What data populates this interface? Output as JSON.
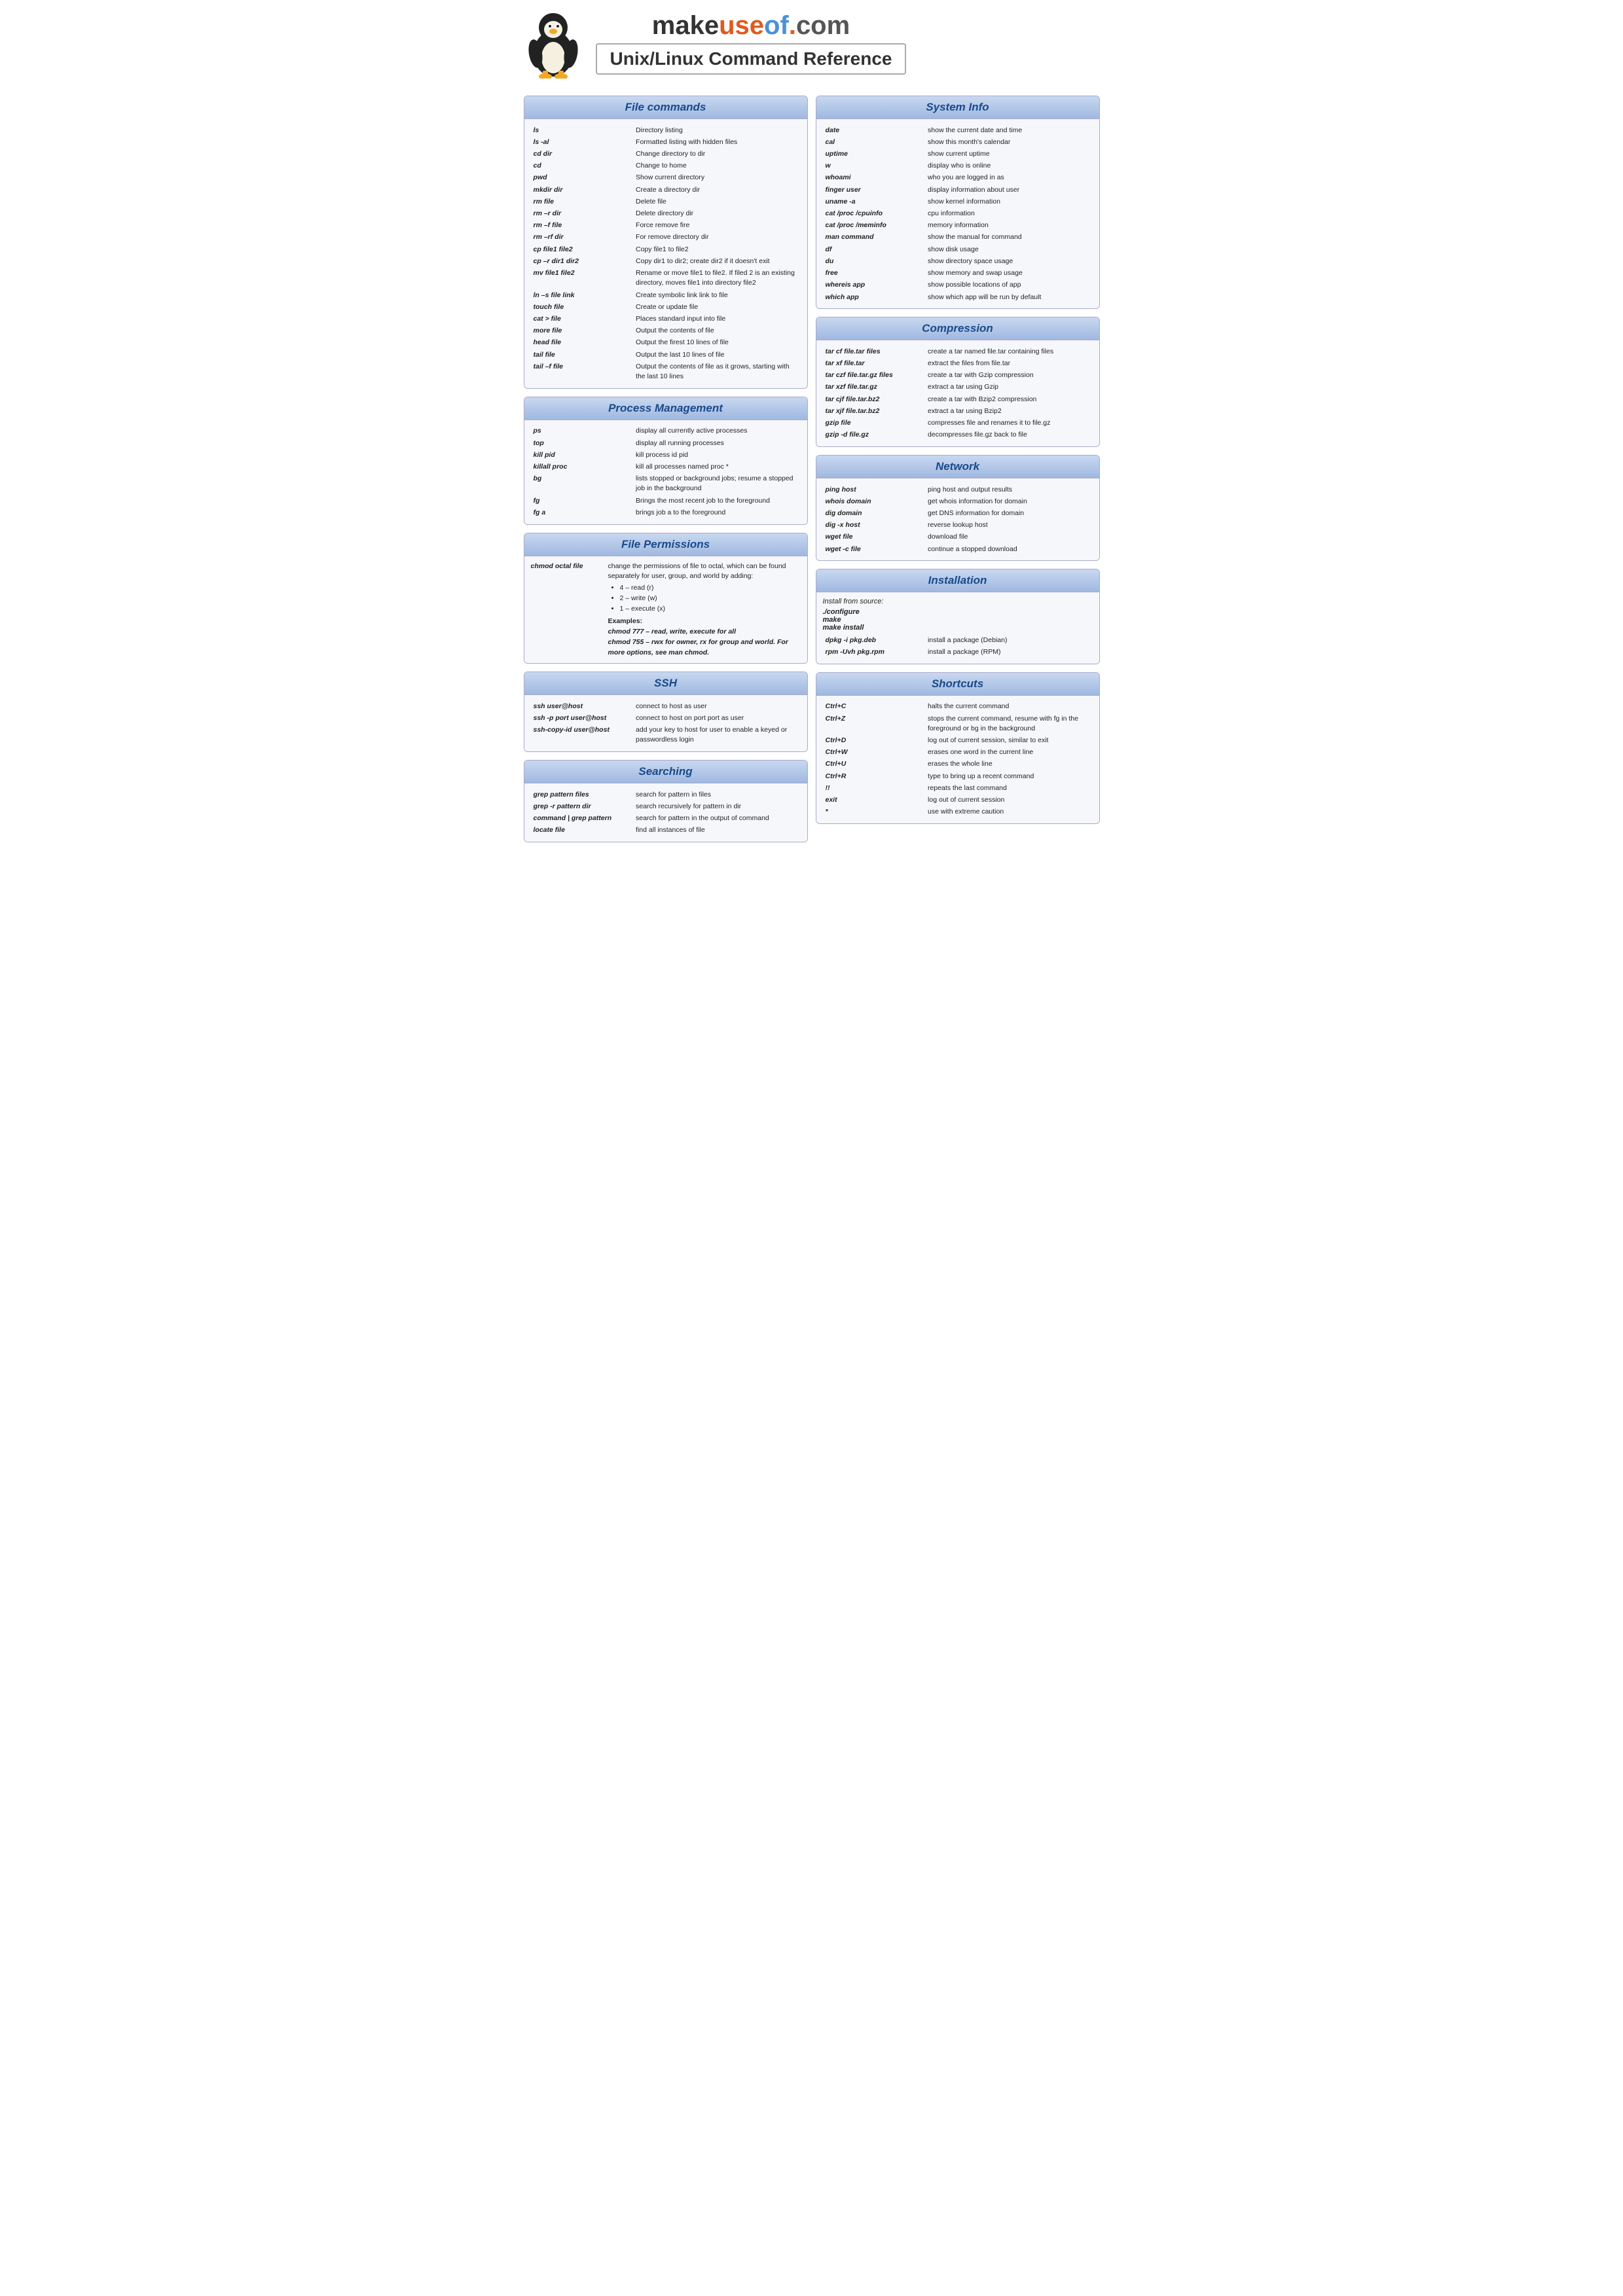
{
  "brand": {
    "make": "make",
    "use": "use",
    "of": "of",
    "dot": ".",
    "com": "com",
    "tagline": "Unix/Linux Command Reference"
  },
  "sections": {
    "file_commands": {
      "title": "File commands",
      "commands": [
        {
          "cmd": "ls",
          "desc": "Directory listing"
        },
        {
          "cmd": "ls -al",
          "desc": "Formatted listing with hidden files"
        },
        {
          "cmd": "cd dir",
          "desc": "Change directory to dir"
        },
        {
          "cmd": "cd",
          "desc": "Change to home"
        },
        {
          "cmd": "pwd",
          "desc": "Show current directory"
        },
        {
          "cmd": "mkdir dir",
          "desc": "Create a directory dir"
        },
        {
          "cmd": "rm file",
          "desc": "Delete file"
        },
        {
          "cmd": "rm –r dir",
          "desc": "Delete directory dir"
        },
        {
          "cmd": "rm –f file",
          "desc": "Force remove fire"
        },
        {
          "cmd": "rm –rf dir",
          "desc": "For remove directory dir"
        },
        {
          "cmd": "cp file1 file2",
          "desc": "Copy file1 to file2"
        },
        {
          "cmd": "cp –r dir1 dir2",
          "desc": "Copy dir1 to dir2; create dir2 if it doesn't exit"
        },
        {
          "cmd": "mv file1 file2",
          "desc": "Rename or move file1 to file2. If filed 2 is an existing directory, moves file1 into directory file2"
        },
        {
          "cmd": "ln –s file link",
          "desc": "Create symbolic link link to file"
        },
        {
          "cmd": "touch file",
          "desc": "Create or update file"
        },
        {
          "cmd": "cat > file",
          "desc": "Places standard input into file"
        },
        {
          "cmd": "more file",
          "desc": "Output the contents of file"
        },
        {
          "cmd": "head file",
          "desc": "Output the firest 10 lines of file"
        },
        {
          "cmd": "tail file",
          "desc": "Output the last 10 lines of file"
        },
        {
          "cmd": "tail –f file",
          "desc": "Output the contents of file as it grows, starting with the last 10 lines"
        }
      ]
    },
    "process_management": {
      "title": "Process Management",
      "commands": [
        {
          "cmd": "ps",
          "desc": "display all currently active processes"
        },
        {
          "cmd": "top",
          "desc": "display all running processes"
        },
        {
          "cmd": "kill pid",
          "desc": "kill process id pid"
        },
        {
          "cmd": "killall proc",
          "desc": "kill all processes named proc *"
        },
        {
          "cmd": "bg",
          "desc": "lists stopped or background jobs; resume a stopped job in the background"
        },
        {
          "cmd": "fg",
          "desc": "Brings the most recent job to the foreground"
        },
        {
          "cmd": "fg a",
          "desc": "brings job a to the foreground"
        }
      ]
    },
    "file_permissions": {
      "title": "File Permissions",
      "chmod_cmd": "chmod octal file",
      "chmod_desc": "change the permissions of file to octal, which can be found separately for user, group, and world by adding:",
      "chmod_items": [
        "4 – read (r)",
        "2 – write (w)",
        "1 – execute (x)"
      ],
      "examples_label": "Examples:",
      "example1": "chmod 777 – read, write, execute for all",
      "example2": "chmod 755 – rwx for owner, rx for group and world. For more options, see man chmod."
    },
    "ssh": {
      "title": "SSH",
      "commands": [
        {
          "cmd": "ssh user@host",
          "desc": "connect to host as user"
        },
        {
          "cmd": "ssh -p port user@host",
          "desc": "connect to host on port port as user"
        },
        {
          "cmd": "ssh-copy-id user@host",
          "desc": "add your key to host for user to enable a keyed or passwordless login"
        }
      ]
    },
    "searching": {
      "title": "Searching",
      "commands": [
        {
          "cmd": "grep pattern files",
          "desc": "search for pattern in files"
        },
        {
          "cmd": "grep -r pattern dir",
          "desc": "search recursively for pattern in dir"
        },
        {
          "cmd": "command | grep pattern",
          "desc": "search for pattern in the output of command"
        },
        {
          "cmd": "locate file",
          "desc": "find all instances of file"
        }
      ]
    },
    "system_info": {
      "title": "System Info",
      "commands": [
        {
          "cmd": "date",
          "desc": "show the current date and time"
        },
        {
          "cmd": "cal",
          "desc": "show this month's calendar"
        },
        {
          "cmd": "uptime",
          "desc": "show current uptime"
        },
        {
          "cmd": "w",
          "desc": "display who is online"
        },
        {
          "cmd": "whoami",
          "desc": "who you are logged in as"
        },
        {
          "cmd": "finger user",
          "desc": "display information about user"
        },
        {
          "cmd": "uname -a",
          "desc": "show kernel information"
        },
        {
          "cmd": "cat /proc /cpuinfo",
          "desc": "cpu information"
        },
        {
          "cmd": "cat /proc /meminfo",
          "desc": "memory information"
        },
        {
          "cmd": "man command",
          "desc": "show the manual for command"
        },
        {
          "cmd": "df",
          "desc": "show disk usage"
        },
        {
          "cmd": "du",
          "desc": "show directory space usage"
        },
        {
          "cmd": "free",
          "desc": "show memory and swap usage"
        },
        {
          "cmd": "whereis app",
          "desc": "show possible locations of app"
        },
        {
          "cmd": "which app",
          "desc": "show which app will be run by default"
        }
      ]
    },
    "compression": {
      "title": "Compression",
      "commands": [
        {
          "cmd": "tar cf file.tar files",
          "desc": "create a tar named file.tar containing files"
        },
        {
          "cmd": "tar xf file.tar",
          "desc": "extract the files from file.tar"
        },
        {
          "cmd": "tar czf file.tar.gz files",
          "desc": "create a tar with Gzip compression"
        },
        {
          "cmd": "tar xzf file.tar.gz",
          "desc": "extract a tar using Gzip"
        },
        {
          "cmd": "tar cjf file.tar.bz2",
          "desc": "create a tar with Bzip2 compression"
        },
        {
          "cmd": "tar xjf file.tar.bz2",
          "desc": "extract a tar using Bzip2"
        },
        {
          "cmd": "gzip file",
          "desc": "compresses file and renames it to file.gz"
        },
        {
          "cmd": "gzip -d file.gz",
          "desc": "decompresses file.gz back to file"
        }
      ]
    },
    "network": {
      "title": "Network",
      "commands": [
        {
          "cmd": "ping host",
          "desc": "ping host and output results"
        },
        {
          "cmd": "whois domain",
          "desc": "get whois information for domain"
        },
        {
          "cmd": "dig domain",
          "desc": "get DNS information for domain"
        },
        {
          "cmd": "dig -x host",
          "desc": "reverse lookup host"
        },
        {
          "cmd": "wget file",
          "desc": "download file"
        },
        {
          "cmd": "wget -c file",
          "desc": "continue a stopped download"
        }
      ]
    },
    "installation": {
      "title": "Installation",
      "from_source_label": "Install from source:",
      "source_commands": [
        "./configure",
        "make",
        "make install"
      ],
      "pkg_commands": [
        {
          "cmd": "dpkg -i pkg.deb",
          "desc": "install a package (Debian)"
        },
        {
          "cmd": "rpm -Uvh pkg.rpm",
          "desc": "install a package (RPM)"
        }
      ]
    },
    "shortcuts": {
      "title": "Shortcuts",
      "commands": [
        {
          "cmd": "Ctrl+C",
          "desc": "halts the current command"
        },
        {
          "cmd": "Ctrl+Z",
          "desc": "stops the current command, resume with fg in the foreground or bg in the background"
        },
        {
          "cmd": "Ctrl+D",
          "desc": "log out of current session, similar to exit"
        },
        {
          "cmd": "Ctrl+W",
          "desc": "erases one word in the current line"
        },
        {
          "cmd": "Ctrl+U",
          "desc": "erases the whole line"
        },
        {
          "cmd": "Ctrl+R",
          "desc": "type to bring up a recent command"
        },
        {
          "cmd": "!!",
          "desc": "repeats the last command"
        },
        {
          "cmd": "exit",
          "desc": "log out of current session"
        },
        {
          "cmd": "*",
          "desc": "use with extreme caution"
        }
      ]
    }
  }
}
